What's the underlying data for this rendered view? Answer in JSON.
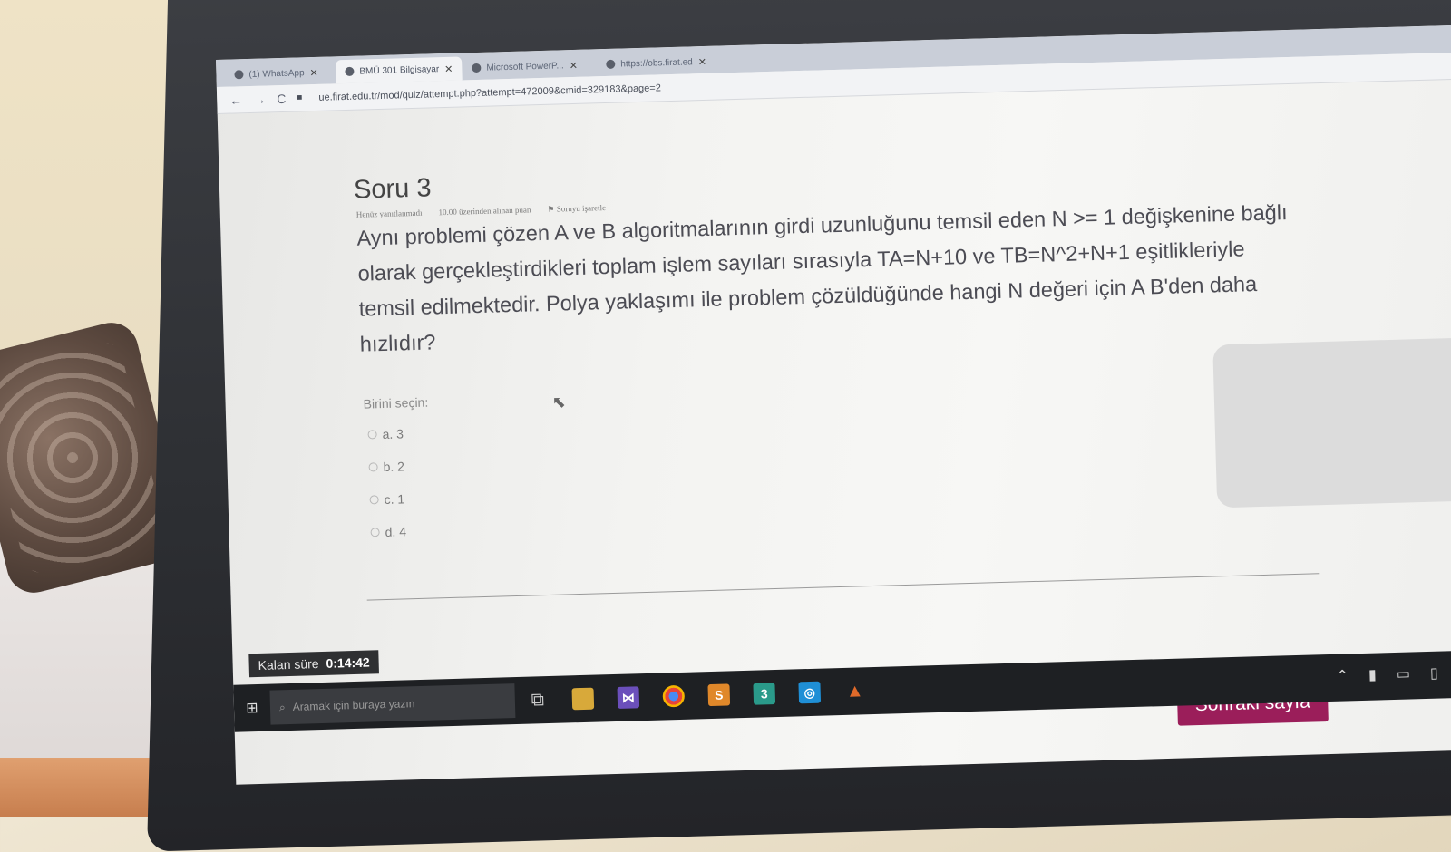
{
  "browser": {
    "tabs": [
      {
        "label": "(1) WhatsApp"
      },
      {
        "label": "BMÜ 301 Bilgisayar"
      },
      {
        "label": "Microsoft PowerP..."
      },
      {
        "label": "https://obs.firat.ed"
      }
    ],
    "url": "ue.firat.edu.tr/mod/quiz/attempt.php?attempt=472009&cmid=329183&page=2"
  },
  "question": {
    "title": "Soru 3",
    "status": "Henüz yanıtlanmadı",
    "points": "10.00 üzerinden alınan puan",
    "flag": "Soruyu işaretle",
    "text": "Aynı problemi çözen A ve B algoritmalarının girdi uzunluğunu temsil eden N >= 1 değişkenine bağlı olarak gerçekleştirdikleri toplam işlem sayıları sırasıyla TA=N+10 ve TB=N^2+N+1 eşitlikleriyle temsil edilmektedir. Polya yaklaşımı ile problem çözüldüğünde hangi N değeri için A B'den daha hızlıdır?",
    "choose_label": "Birini seçin:",
    "options": [
      {
        "label": "a. 3"
      },
      {
        "label": "b. 2"
      },
      {
        "label": "c. 1"
      },
      {
        "label": "d. 4"
      }
    ]
  },
  "timer": {
    "label": "Kalan süre",
    "value": "0:14:42"
  },
  "next_button": "Sonraki sayfa",
  "taskbar": {
    "search_placeholder": "Aramak için buraya yazın"
  },
  "colors": {
    "accent": "#9b1e5a",
    "taskbar": "#1e2023"
  }
}
